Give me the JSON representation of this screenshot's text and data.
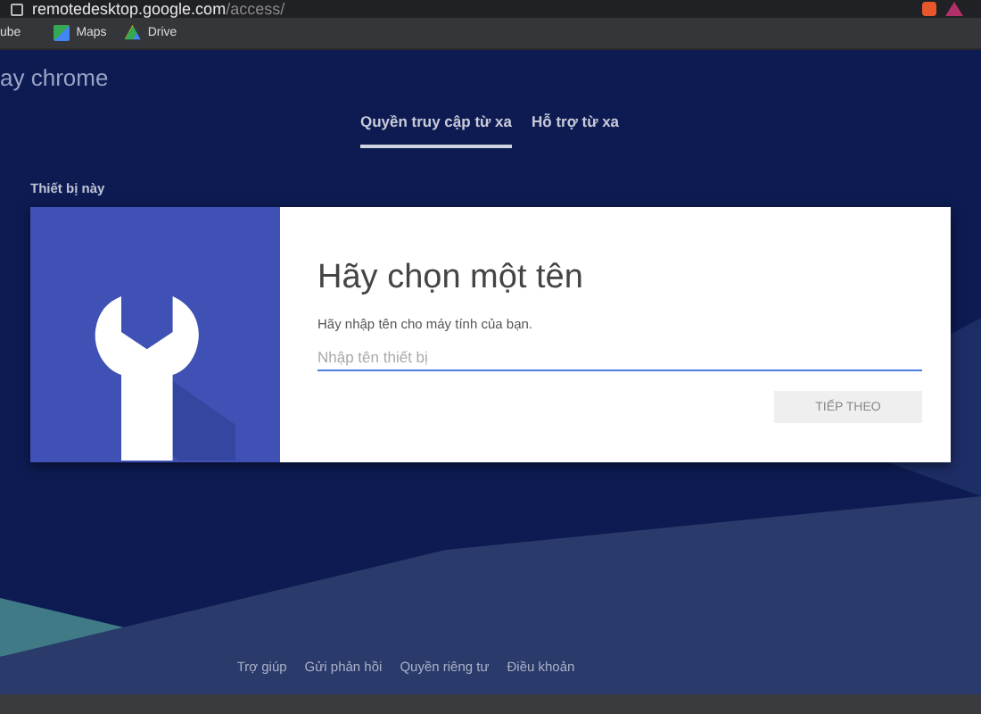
{
  "browser": {
    "url_host": "remotedesktop.google.com",
    "url_path": "/access/",
    "bookmarks": [
      {
        "label": "ube",
        "kind": "plain"
      },
      {
        "label": "Maps",
        "kind": "maps"
      },
      {
        "label": "Drive",
        "kind": "drive"
      }
    ]
  },
  "header": {
    "title": "ay chrome"
  },
  "tabs": [
    {
      "label": "Quyền truy cập từ xa",
      "selected": true
    },
    {
      "label": "Hỗ trợ từ xa",
      "selected": false
    }
  ],
  "section": {
    "title": "Thiết bị này"
  },
  "card": {
    "title": "Hãy chọn một tên",
    "description": "Hãy nhập tên cho máy tính của bạn.",
    "input": {
      "placeholder": "Nhập tên thiết bị"
    },
    "button": {
      "label": "TIẾP THEO",
      "disabled": true
    }
  },
  "footer": {
    "links": [
      "Trợ giúp",
      "Gửi phản hồi",
      "Quyền riêng tư",
      "Điều khoản"
    ]
  }
}
